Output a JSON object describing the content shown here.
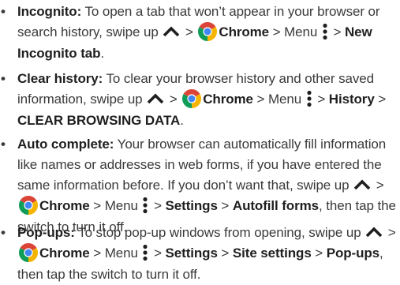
{
  "icons": {
    "swipe_up": "chevron-up-icon",
    "chrome": "chrome-logo-icon",
    "menu": "vertical-dots-menu-icon"
  },
  "colors": {
    "text": "#3a3a3a",
    "chrome_red": "#db4437",
    "chrome_yellow": "#f4b400",
    "chrome_green": "#0f9d58",
    "chrome_blue": "#4285f4"
  },
  "tips": [
    {
      "bullet": "•",
      "term": "Incognito:",
      "t1": " To open a tab that won’t appear in your browser or search history, swipe up ",
      "t2": " > ",
      "chrome": "Chrome",
      "t3": " > Menu ",
      "t4": " > ",
      "b1": "New Incognito tab",
      "t5": "."
    },
    {
      "bullet": "•",
      "term": "Clear history:",
      "t1": " To clear your browser history and other saved information, swipe up ",
      "t2": " > ",
      "chrome": "Chrome",
      "t3": " > Menu ",
      "t4": " > ",
      "b1": "History",
      "t5": " > ",
      "b2": "CLEAR BROWSING DATA",
      "t6": "."
    },
    {
      "bullet": "•",
      "term": "Auto complete:",
      "t1": " Your browser can automatically fill information like names or addresses in web forms, if you have entered the same information before. If you don’t want that, swipe up ",
      "t2": " > ",
      "chrome": "Chrome",
      "t3": " > Menu ",
      "t4": " > ",
      "b1": "Settings",
      "t5": " > ",
      "b2": "Autofill forms",
      "t6": ", then tap the switch to turn it off."
    },
    {
      "bullet": "•",
      "term": "Pop-ups:",
      "t1": " To stop pop-up windows from opening, swipe up ",
      "t2": " > ",
      "chrome": "Chrome",
      "t3": " > Menu ",
      "t4": " > ",
      "b1": "Settings",
      "t5": " > ",
      "b2": "Site settings",
      "t6": " > ",
      "b3": "Pop-ups",
      "t7": ", then tap the switch to turn it off."
    }
  ]
}
